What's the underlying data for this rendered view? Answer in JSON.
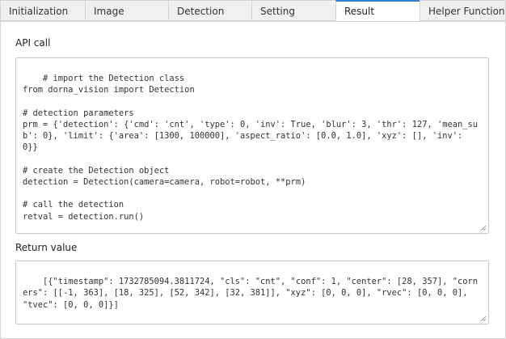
{
  "tabs": [
    {
      "label": "Initialization",
      "active": false
    },
    {
      "label": "Image",
      "active": false
    },
    {
      "label": "Detection",
      "active": false
    },
    {
      "label": "Setting",
      "active": false
    },
    {
      "label": "Result",
      "active": true
    },
    {
      "label": "Helper Functions",
      "active": false
    }
  ],
  "api_call": {
    "label": "API call",
    "code": "# import the Detection class\nfrom dorna_vision import Detection\n\n# detection parameters\nprm = {'detection': {'cmd': 'cnt', 'type': 0, 'inv': True, 'blur': 3, 'thr': 127, 'mean_sub': 0}, 'limit': {'area': [1300, 100000], 'aspect_ratio': [0.0, 1.0], 'xyz': [], 'inv': 0}}\n\n# create the Detection object\ndetection = Detection(camera=camera, robot=robot, **prm)\n\n# call the detection\nretval = detection.run()"
  },
  "return_value": {
    "label": "Return value",
    "code": "[{\"timestamp\": 1732785094.3811724, \"cls\": \"cnt\", \"conf\": 1, \"center\": [28, 357], \"corners\": [[-1, 363], [18, 325], [52, 342], [32, 381]], \"xyz\": [0, 0, 0], \"rvec\": [0, 0, 0], \"tvec\": [0, 0, 0]}]"
  },
  "colors": {
    "active_tab_accent": "#2d7fd6",
    "tab_bg": "#f0f0f0",
    "border": "#c8c8c8"
  },
  "icons": {
    "resize_grip": "resize-grip-icon"
  }
}
